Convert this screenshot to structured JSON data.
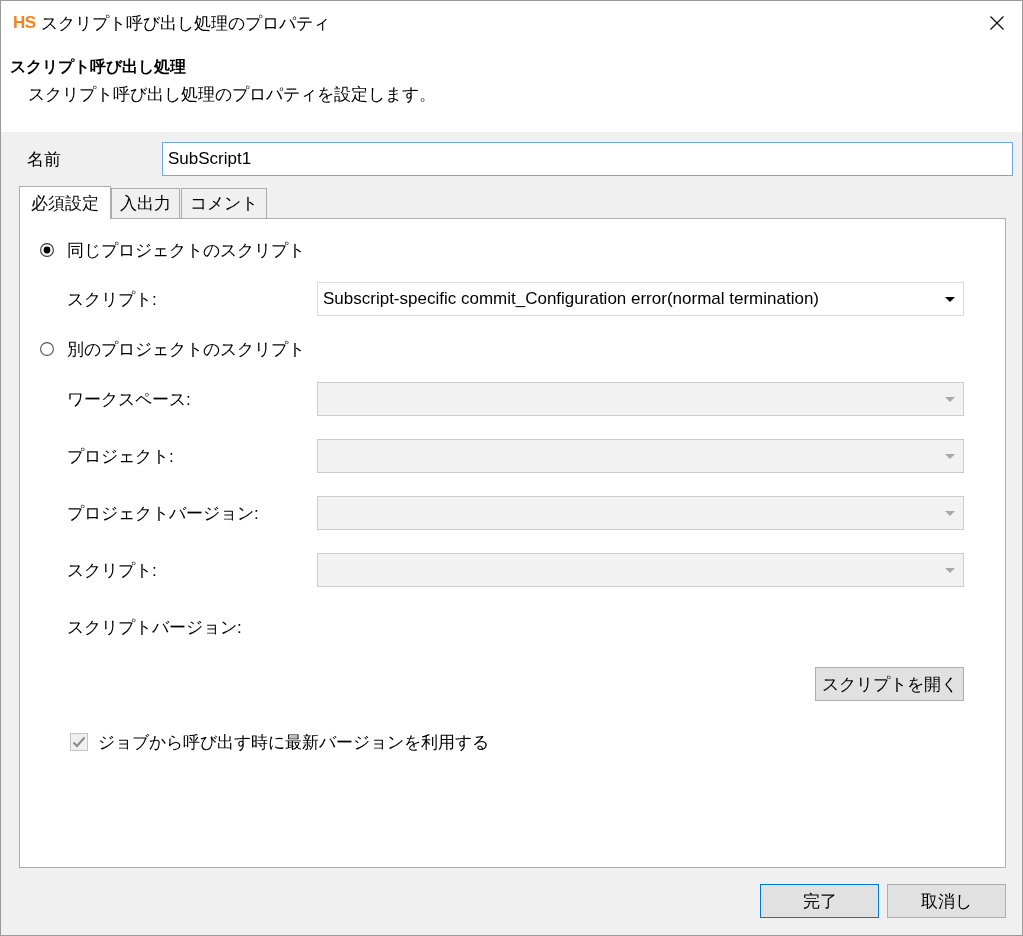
{
  "window": {
    "logo": "HS",
    "title": "スクリプト呼び出し処理のプロパティ"
  },
  "header": {
    "title": "スクリプト呼び出し処理",
    "description": "スクリプト呼び出し処理のプロパティを設定します。"
  },
  "name_field": {
    "label": "名前",
    "value": "SubScript1",
    "focused": true
  },
  "tabs": [
    {
      "label": "必須設定",
      "selected": true
    },
    {
      "label": "入出力",
      "selected": false
    },
    {
      "label": "コメント",
      "selected": false
    }
  ],
  "panel": {
    "options": [
      {
        "label": "同じプロジェクトのスクリプト",
        "selected": true,
        "fields": [
          {
            "kind": "select",
            "label": "スクリプト:",
            "value": "Subscript-specific commit_Configuration error(normal termination)",
            "disabled": false
          }
        ]
      },
      {
        "label": "別のプロジェクトのスクリプト",
        "selected": false,
        "fields": [
          {
            "kind": "select",
            "label": "ワークスペース:",
            "disabled": true
          },
          {
            "kind": "select",
            "label": "プロジェクト:",
            "disabled": true
          },
          {
            "kind": "select",
            "label": "プロジェクトバージョン:",
            "disabled": true
          },
          {
            "kind": "select",
            "label": "スクリプト:",
            "disabled": true
          },
          {
            "kind": "label",
            "label": "スクリプトバージョン:"
          }
        ]
      }
    ],
    "open_button": {
      "label": "スクリプトを開く"
    },
    "checkbox": {
      "label": "ジョブから呼び出す時に最新バージョンを利用する",
      "checked": true,
      "disabled": true
    }
  },
  "buttons": [
    {
      "label": "完了",
      "default": true
    },
    {
      "label": "取消し",
      "default": false
    }
  ]
}
